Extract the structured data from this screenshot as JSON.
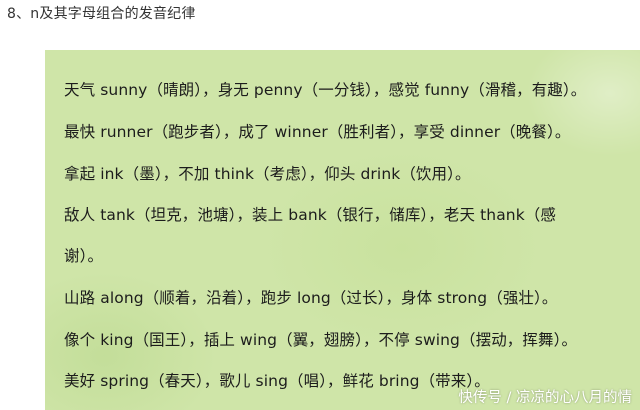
{
  "heading": "8、n及其字母组合的发音纪律",
  "lines": [
    "天气 sunny（晴朗），身无 penny（一分钱），感觉 funny（滑稽，有趣）。",
    "最快 runner（跑步者），成了 winner（胜利者），享受 dinner（晚餐）。",
    "拿起 ink（墨），不加 think（考虑），仰头 drink（饮用）。",
    "敌人 tank（坦克，池塘），装上 bank（银行，储库），老天 thank（感",
    "谢）。",
    "山路 along（顺着，沿着），跑步 long（过长），身体 strong（强壮）。",
    "像个 king（国王），插上 wing（翼，翅膀），不停 swing（摆动，挥舞）。",
    "美好 spring（春天），歌儿 sing（唱），鲜花 bring（带来）。"
  ],
  "watermark": "快传号 / 凉凉的心八月的情",
  "colors": {
    "card_background": "#cfe5a8",
    "text": "#1c1c1c",
    "heading_text": "#333333"
  }
}
